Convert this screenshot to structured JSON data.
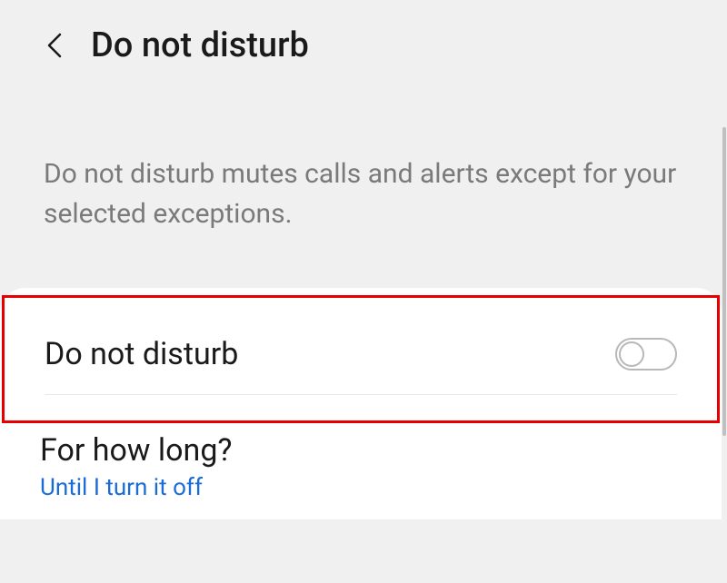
{
  "header": {
    "title": "Do not disturb"
  },
  "description": "Do not disturb mutes calls and alerts except for your selected exceptions.",
  "settings": {
    "dnd": {
      "label": "Do not disturb"
    },
    "duration": {
      "label": "For how long?",
      "value": "Until I turn it off"
    }
  }
}
